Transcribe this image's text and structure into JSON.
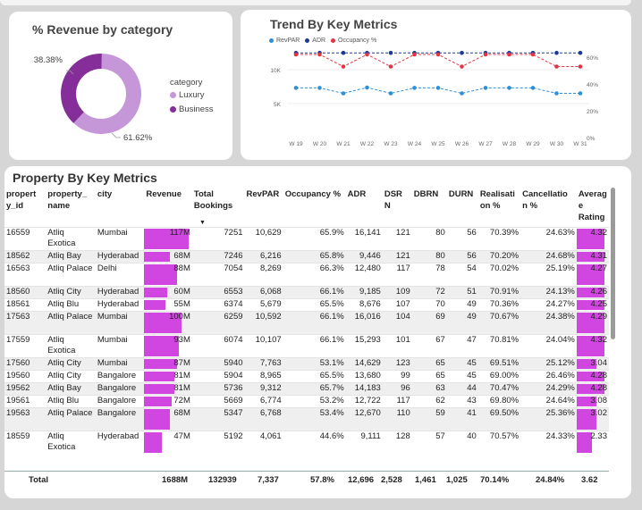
{
  "donut": {
    "title": "% Revenue by category",
    "legend_title": "category",
    "slices": [
      {
        "name": "Luxury",
        "percent": 61.62,
        "label": "61.62%",
        "color": "#c597d8"
      },
      {
        "name": "Business",
        "percent": 38.38,
        "label": "38.38%",
        "color": "#852e99"
      }
    ]
  },
  "chart_data": {
    "type": "line",
    "title": "Trend By Key Metrics",
    "x": [
      "W 19",
      "W 20",
      "W 21",
      "W 22",
      "W 23",
      "W 24",
      "W 25",
      "W 26",
      "W 27",
      "W 28",
      "W 29",
      "W 30",
      "W 31"
    ],
    "left_axis_ticks": [
      "10K",
      "5K"
    ],
    "right_axis_ticks": [
      "60%",
      "40%",
      "20%",
      "0%"
    ],
    "left_ylim": [
      0,
      13000
    ],
    "right_ylim": [
      0,
      0.66
    ],
    "legend_placement": "top-left",
    "series": [
      {
        "name": "RevPAR",
        "color": "#2d8fd5",
        "axis": "left",
        "values": [
          7300,
          7300,
          6500,
          7350,
          6500,
          7300,
          7300,
          6500,
          7300,
          7300,
          7300,
          6500,
          6500
        ]
      },
      {
        "name": "ADR",
        "color": "#1f3a93",
        "axis": "left",
        "values": [
          12450,
          12450,
          12450,
          12450,
          12450,
          12450,
          12450,
          12450,
          12450,
          12450,
          12450,
          12450,
          12450
        ]
      },
      {
        "name": "Occupancy %",
        "color": "#e03546",
        "axis": "right",
        "values": [
          0.62,
          0.62,
          0.53,
          0.62,
          0.53,
          0.62,
          0.62,
          0.53,
          0.62,
          0.62,
          0.62,
          0.53,
          0.53
        ]
      }
    ]
  },
  "table": {
    "title": "Property By Key Metrics",
    "columns": [
      "property_id",
      "property_name",
      "city",
      "Revenue",
      "Total Bookings",
      "RevPAR",
      "Occupancy %",
      "ADR",
      "DSRN",
      "DBRN",
      "DURN",
      "Realisation %",
      "Cancellation %",
      "Average Rating"
    ],
    "headers": {
      "c0": "propert y_id",
      "c1": "property_ name",
      "c2": "city",
      "c3": "Revenue",
      "c4": "Total Bookings",
      "c5": "RevPAR",
      "c6": "Occupancy %",
      "c7": "ADR",
      "c8": "DSR N",
      "c9": "DBRN",
      "c10": "DURN",
      "c11": "Realisati on %",
      "c12": "Cancellatio n %",
      "c13": "Averag e Rating"
    },
    "sort_icon": "caret-down-icon",
    "bar_color": "#d146e0",
    "rows": [
      {
        "id": "16559",
        "name": "Atliq Exotica",
        "city": "Mumbai",
        "revenue": "117M",
        "rev_num": 117,
        "bookings": "7251",
        "revpar": "10,629",
        "occ": "65.9%",
        "adr": "16,141",
        "dsrn": "121",
        "dbrn": "80",
        "durn": "56",
        "real": "70.39%",
        "canc": "24.63%",
        "rating": "4.32",
        "rating_num": 4.32
      },
      {
        "id": "18562",
        "name": "Atliq Bay",
        "city": "Hyderabad",
        "revenue": "68M",
        "rev_num": 68,
        "bookings": "7246",
        "revpar": "6,216",
        "occ": "65.8%",
        "adr": "9,446",
        "dsrn": "121",
        "dbrn": "80",
        "durn": "56",
        "real": "70.20%",
        "canc": "24.68%",
        "rating": "4.31",
        "rating_num": 4.31
      },
      {
        "id": "16563",
        "name": "Atliq Palace",
        "city": "Delhi",
        "revenue": "88M",
        "rev_num": 88,
        "bookings": "7054",
        "revpar": "8,269",
        "occ": "66.3%",
        "adr": "12,480",
        "dsrn": "117",
        "dbrn": "78",
        "durn": "54",
        "real": "70.02%",
        "canc": "25.19%",
        "rating": "4.27",
        "rating_num": 4.27
      },
      {
        "id": "18560",
        "name": "Atliq City",
        "city": "Hyderabad",
        "revenue": "60M",
        "rev_num": 60,
        "bookings": "6553",
        "revpar": "6,068",
        "occ": "66.1%",
        "adr": "9,185",
        "dsrn": "109",
        "dbrn": "72",
        "durn": "51",
        "real": "70.91%",
        "canc": "24.13%",
        "rating": "4.26",
        "rating_num": 4.26
      },
      {
        "id": "18561",
        "name": "Atliq Blu",
        "city": "Hyderabad",
        "revenue": "55M",
        "rev_num": 55,
        "bookings": "6374",
        "revpar": "5,679",
        "occ": "65.5%",
        "adr": "8,676",
        "dsrn": "107",
        "dbrn": "70",
        "durn": "49",
        "real": "70.36%",
        "canc": "24.27%",
        "rating": "4.25",
        "rating_num": 4.25
      },
      {
        "id": "17563",
        "name": "Atliq Palace",
        "city": "Mumbai",
        "revenue": "100M",
        "rev_num": 100,
        "bookings": "6259",
        "revpar": "10,592",
        "occ": "66.1%",
        "adr": "16,016",
        "dsrn": "104",
        "dbrn": "69",
        "durn": "49",
        "real": "70.67%",
        "canc": "24.38%",
        "rating": "4.29",
        "rating_num": 4.29
      },
      {
        "id": "17559",
        "name": "Atliq Exotica",
        "city": "Mumbai",
        "revenue": "93M",
        "rev_num": 93,
        "bookings": "6074",
        "revpar": "10,107",
        "occ": "66.1%",
        "adr": "15,293",
        "dsrn": "101",
        "dbrn": "67",
        "durn": "47",
        "real": "70.81%",
        "canc": "24.04%",
        "rating": "4.32",
        "rating_num": 4.32
      },
      {
        "id": "17560",
        "name": "Atliq City",
        "city": "Mumbai",
        "revenue": "87M",
        "rev_num": 87,
        "bookings": "5940",
        "revpar": "7,763",
        "occ": "53.1%",
        "adr": "14,629",
        "dsrn": "123",
        "dbrn": "65",
        "durn": "45",
        "real": "69.51%",
        "canc": "25.12%",
        "rating": "3.04",
        "rating_num": 3.04
      },
      {
        "id": "19560",
        "name": "Atliq City",
        "city": "Bangalore",
        "revenue": "81M",
        "rev_num": 81,
        "bookings": "5904",
        "revpar": "8,965",
        "occ": "65.5%",
        "adr": "13,680",
        "dsrn": "99",
        "dbrn": "65",
        "durn": "45",
        "real": "69.00%",
        "canc": "26.46%",
        "rating": "4.28",
        "rating_num": 4.28
      },
      {
        "id": "19562",
        "name": "Atliq Bay",
        "city": "Bangalore",
        "revenue": "81M",
        "rev_num": 81,
        "bookings": "5736",
        "revpar": "9,312",
        "occ": "65.7%",
        "adr": "14,183",
        "dsrn": "96",
        "dbrn": "63",
        "durn": "44",
        "real": "70.47%",
        "canc": "24.29%",
        "rating": "4.28",
        "rating_num": 4.28
      },
      {
        "id": "19561",
        "name": "Atliq Blu",
        "city": "Bangalore",
        "revenue": "72M",
        "rev_num": 72,
        "bookings": "5669",
        "revpar": "6,774",
        "occ": "53.2%",
        "adr": "12,722",
        "dsrn": "117",
        "dbrn": "62",
        "durn": "43",
        "real": "69.80%",
        "canc": "24.64%",
        "rating": "3.08",
        "rating_num": 3.08
      },
      {
        "id": "19563",
        "name": "Atliq Palace",
        "city": "Bangalore",
        "revenue": "68M",
        "rev_num": 68,
        "bookings": "5347",
        "revpar": "6,768",
        "occ": "53.4%",
        "adr": "12,670",
        "dsrn": "110",
        "dbrn": "59",
        "durn": "41",
        "real": "69.50%",
        "canc": "25.36%",
        "rating": "3.02",
        "rating_num": 3.02
      },
      {
        "id": "18559",
        "name": "Atliq Exotica",
        "city": "Hyderabad",
        "revenue": "47M",
        "rev_num": 47,
        "bookings": "5192",
        "revpar": "4,061",
        "occ": "44.6%",
        "adr": "9,111",
        "dsrn": "128",
        "dbrn": "57",
        "durn": "40",
        "real": "70.57%",
        "canc": "24.33%",
        "rating": "2.33",
        "rating_num": 2.33
      }
    ],
    "totals": {
      "label": "Total",
      "revenue": "1688M",
      "bookings": "132939",
      "revpar": "7,337",
      "occ": "57.8%",
      "adr": "12,696",
      "dsrn": "2,528",
      "dbrn": "1,461",
      "durn": "1,025",
      "real": "70.14%",
      "canc": "24.84%",
      "rating": "3.62"
    }
  }
}
